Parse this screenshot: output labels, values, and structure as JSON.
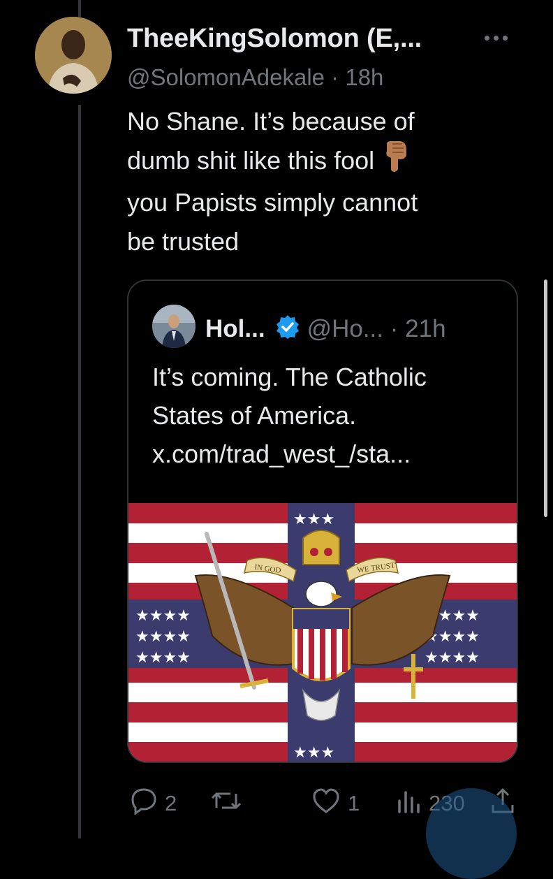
{
  "tweet": {
    "display_name": "TheeKingSolomon (E,...",
    "handle": "@SolomonAdekale",
    "separator": "·",
    "time": "18h",
    "text_lines": [
      "No Shane. It’s because of",
      "dumb shit like this fool",
      "you Papists simply cannot",
      "be trusted"
    ],
    "more_icon": "more-horizontal-icon"
  },
  "quote": {
    "display_name": "Hol...",
    "verified": "verified-badge-icon",
    "handle": "@Ho...",
    "separator": "·",
    "time": "21h",
    "text_lines": [
      "It’s coming. The Catholic",
      "States of America.",
      "x.com/trad_west_/sta..."
    ],
    "image": {
      "banner_left": "IN GOD",
      "banner_right": "WE TRUST"
    }
  },
  "actions": {
    "replies": "2",
    "retweets": "",
    "likes": "1",
    "views": "230"
  },
  "colors": {
    "background": "#000000",
    "text": "#e7e9ea",
    "muted": "#71767b",
    "verified": "#1d9bf0",
    "flag_red": "#b22234",
    "flag_blue": "#3c3b6e"
  }
}
